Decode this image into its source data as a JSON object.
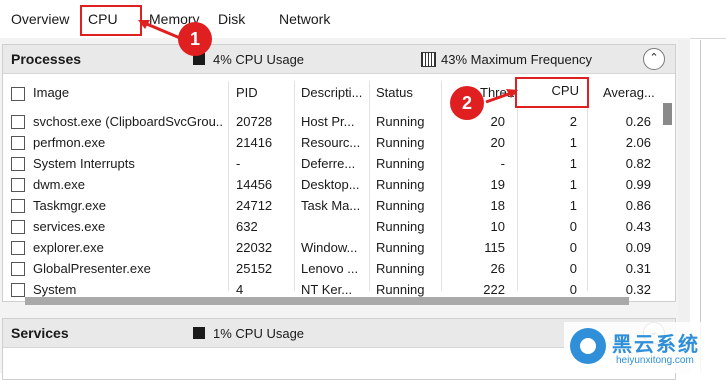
{
  "tabs": [
    "Overview",
    "CPU",
    "Memory",
    "Disk",
    "Network"
  ],
  "processes": {
    "title": "Processes",
    "cpu_usage": "4% CPU Usage",
    "max_frequency": "43% Maximum Frequency",
    "columns": [
      "Image",
      "PID",
      "Descripti...",
      "Status",
      "Threads",
      "CPU",
      "Averag..."
    ],
    "rows": [
      {
        "image": "svchost.exe (ClipboardSvcGrou...",
        "pid": "20728",
        "desc": "Host Pr...",
        "status": "Running",
        "threads": "20",
        "cpu": "2",
        "avg": "0.26"
      },
      {
        "image": "perfmon.exe",
        "pid": "21416",
        "desc": "Resourc...",
        "status": "Running",
        "threads": "20",
        "cpu": "1",
        "avg": "2.06"
      },
      {
        "image": "System Interrupts",
        "pid": "-",
        "desc": "Deferre...",
        "status": "Running",
        "threads": "-",
        "cpu": "1",
        "avg": "0.82"
      },
      {
        "image": "dwm.exe",
        "pid": "14456",
        "desc": "Desktop...",
        "status": "Running",
        "threads": "19",
        "cpu": "1",
        "avg": "0.99"
      },
      {
        "image": "Taskmgr.exe",
        "pid": "24712",
        "desc": "Task Ma...",
        "status": "Running",
        "threads": "18",
        "cpu": "1",
        "avg": "0.86"
      },
      {
        "image": "services.exe",
        "pid": "632",
        "desc": "",
        "status": "Running",
        "threads": "10",
        "cpu": "0",
        "avg": "0.43"
      },
      {
        "image": "explorer.exe",
        "pid": "22032",
        "desc": "Window...",
        "status": "Running",
        "threads": "115",
        "cpu": "0",
        "avg": "0.09"
      },
      {
        "image": "GlobalPresenter.exe",
        "pid": "25152",
        "desc": "Lenovo ...",
        "status": "Running",
        "threads": "26",
        "cpu": "0",
        "avg": "0.31"
      },
      {
        "image": "System",
        "pid": "4",
        "desc": "NT Ker...",
        "status": "Running",
        "threads": "222",
        "cpu": "0",
        "avg": "0.32"
      }
    ]
  },
  "services": {
    "title": "Services",
    "cpu_usage": "1% CPU Usage"
  },
  "annotations": {
    "badge1": "1",
    "badge2": "2"
  },
  "watermark": {
    "cn": "黑云系统",
    "en": "heiyunxitong.com"
  },
  "colors": {
    "callout": "#e02020",
    "watermark": "#2f8fd8"
  }
}
